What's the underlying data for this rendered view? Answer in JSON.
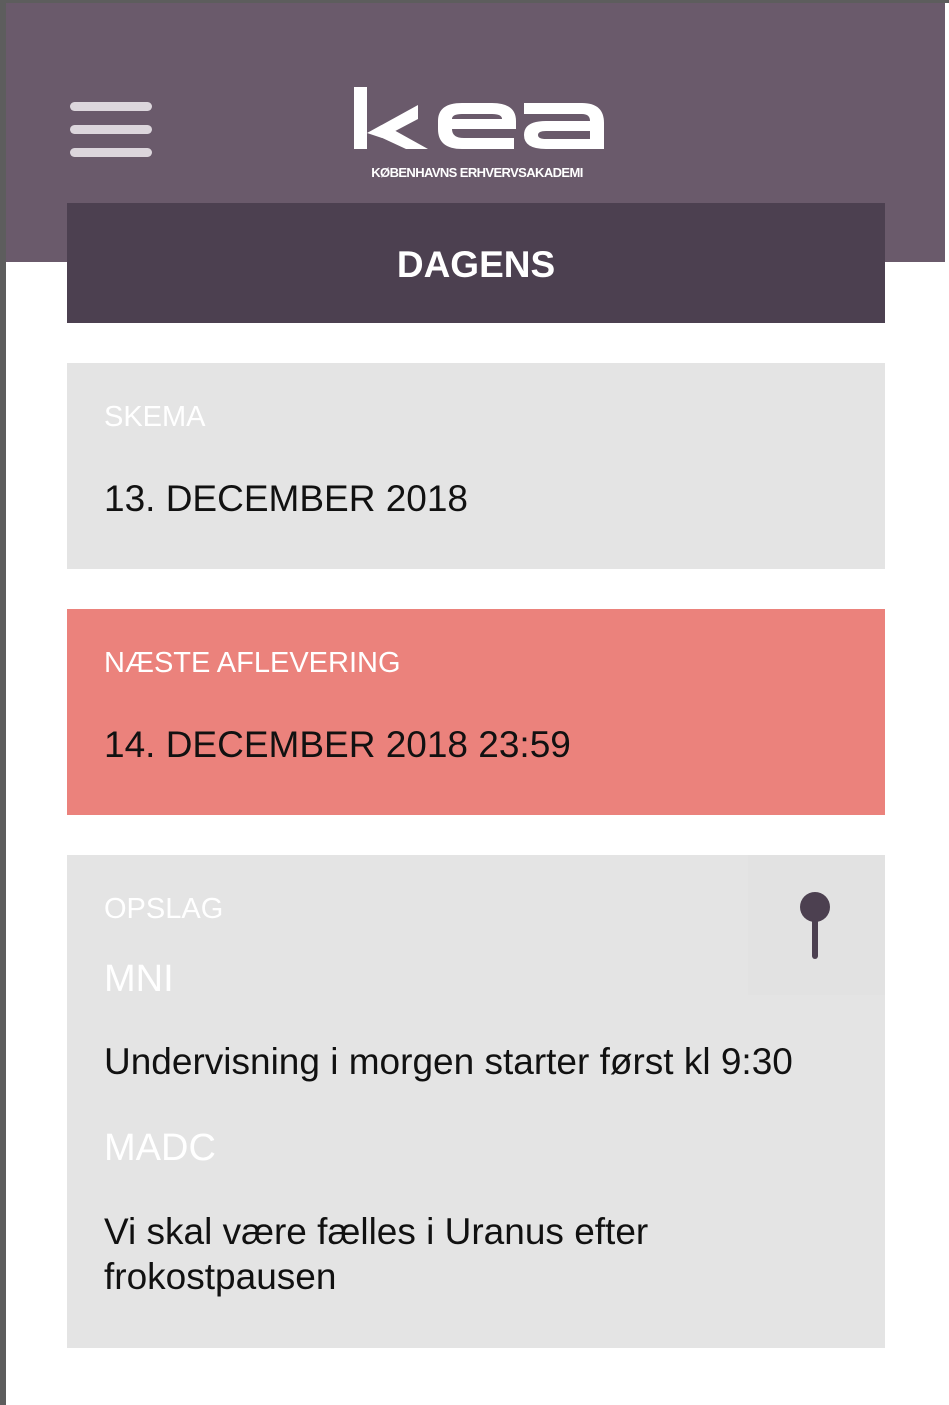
{
  "header": {
    "logo_text": "kea",
    "logo_subtitle": "KØBENHAVNS ERHVERVSAKADEMI",
    "background": "#6a5a6b"
  },
  "title_bar": {
    "title": "DAGENS",
    "background": "#4c4050"
  },
  "cards": {
    "skema": {
      "label": "SKEMA",
      "value": "13. DECEMBER 2018"
    },
    "aflevering": {
      "label": "NÆSTE AFLEVERING",
      "value": "14. DECEMBER 2018 23:59",
      "color": "#eb827c"
    },
    "opslag": {
      "label": "OPSLAG",
      "icon": "pin-icon",
      "posts": [
        {
          "author": "MNI",
          "text": "Undervisning i morgen starter først kl 9:30"
        },
        {
          "author": "MADC",
          "text": "Vi skal være fælles i Uranus efter frokostpausen"
        }
      ]
    }
  }
}
